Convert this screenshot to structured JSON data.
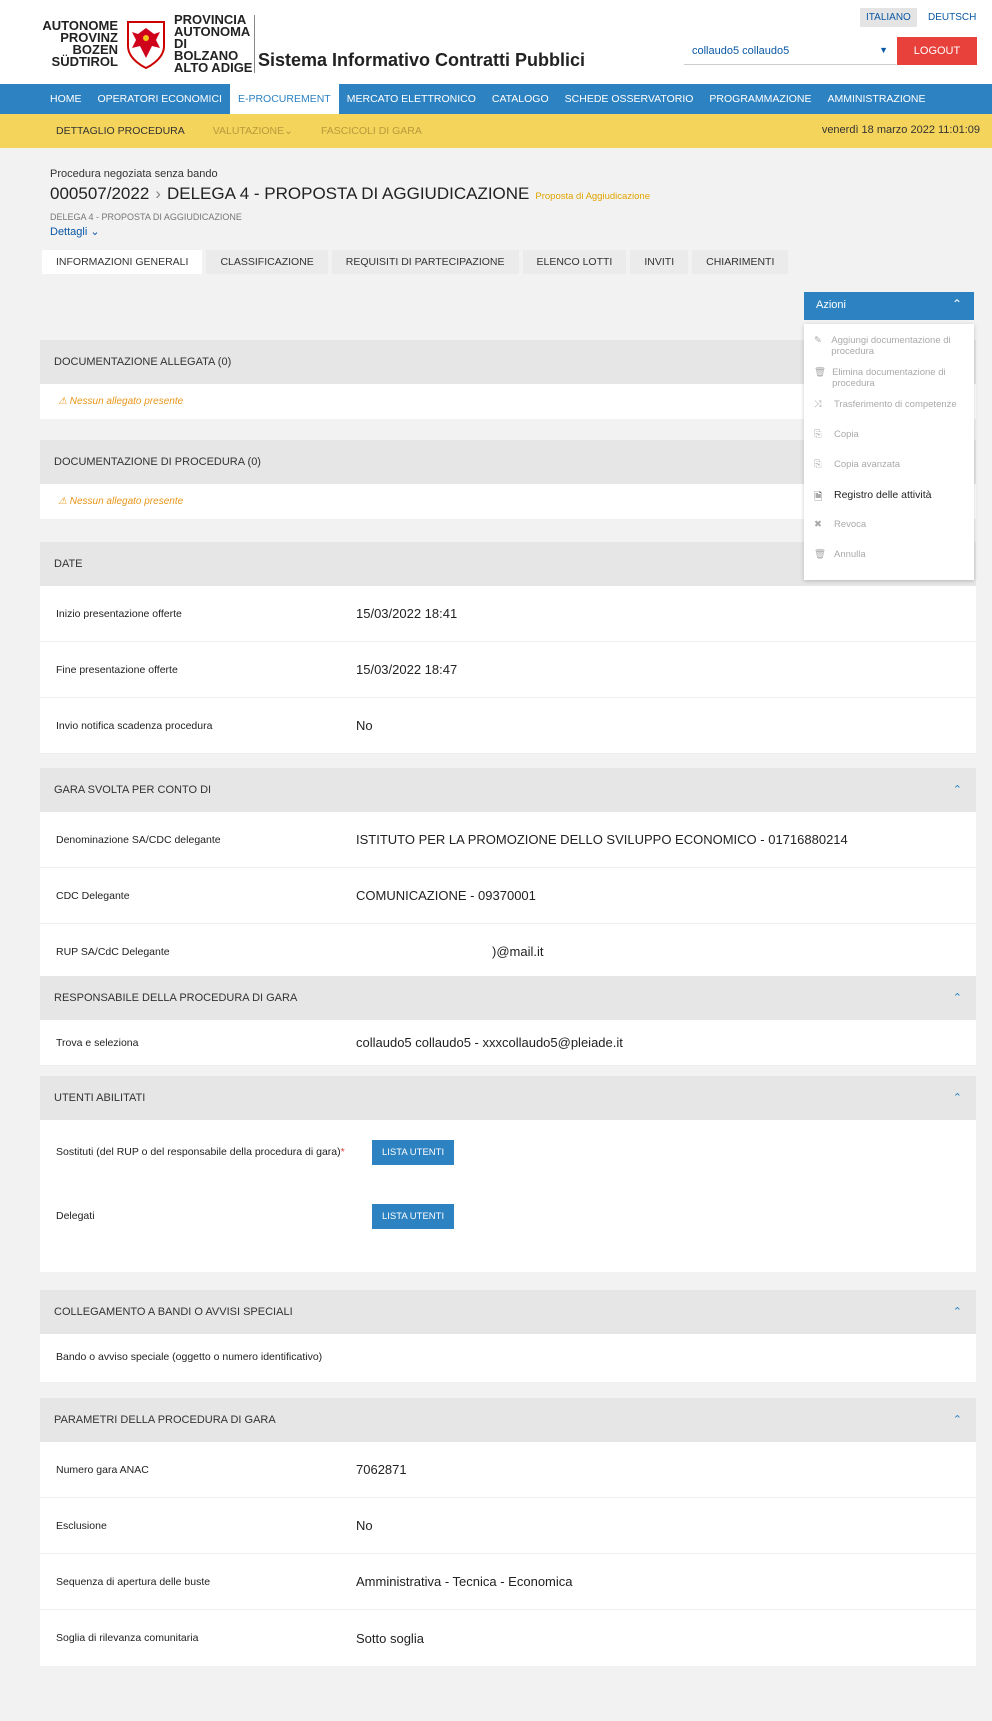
{
  "header": {
    "logo_left_lines": [
      "AUTONOME",
      "PROVINZ",
      "BOZEN",
      "SÜDTIROL"
    ],
    "logo_right_lines": [
      "PROVINCIA",
      "AUTONOMA",
      "DI BOLZANO",
      "ALTO ADIGE"
    ],
    "app_title": "Sistema Informativo Contratti Pubblici",
    "lang_it": "ITALIANO",
    "lang_de": "DEUTSCH",
    "user": "collaudo5 collaudo5",
    "logout": "LOGOUT"
  },
  "nav": {
    "items": [
      "HOME",
      "OPERATORI ECONOMICI",
      "E-PROCUREMENT",
      "MERCATO ELETTRONICO",
      "CATALOGO",
      "SCHEDE OSSERVATORIO",
      "PROGRAMMAZIONE",
      "AMMINISTRAZIONE"
    ],
    "active_index": 2
  },
  "subnav": {
    "items": [
      "DETTAGLIO PROCEDURA",
      "VALUTAZIONE",
      "FASCICOLI DI GARA"
    ],
    "datetime": "venerdì 18 marzo 2022 11:01:09"
  },
  "procedure": {
    "type": "Procedura negoziata senza bando",
    "code": "000507/2022",
    "name": "DELEGA 4 - PROPOSTA DI AGGIUDICAZIONE",
    "status": "Proposta di Aggiudicazione",
    "subtitle": "DELEGA 4 - PROPOSTA DI AGGIUDICAZIONE",
    "details": "Dettagli"
  },
  "tabs": [
    "INFORMAZIONI GENERALI",
    "CLASSIFICAZIONE",
    "REQUISITI DI PARTECIPAZIONE",
    "ELENCO LOTTI",
    "INVITI",
    "CHIARIMENTI"
  ],
  "actions": {
    "button": "Azioni",
    "items": [
      {
        "label": "Aggiungi documentazione di procedura",
        "icon": "edit-icon",
        "glyph": "✎",
        "enabled": false
      },
      {
        "label": "Elimina documentazione di procedura",
        "icon": "trash-icon",
        "glyph": "🗑",
        "enabled": false
      },
      {
        "label": "Trasferimento di competenze",
        "icon": "shuffle-icon",
        "glyph": "⤨",
        "enabled": false
      },
      {
        "label": "Copia",
        "icon": "copy-icon",
        "glyph": "⎘",
        "enabled": false
      },
      {
        "label": "Copia avanzata",
        "icon": "copy-advanced-icon",
        "glyph": "⎘",
        "enabled": false
      },
      {
        "label": "Registro delle attività",
        "icon": "document-icon",
        "glyph": "🗎",
        "enabled": true
      },
      {
        "label": "Revoca",
        "icon": "revoke-icon",
        "glyph": "✖",
        "enabled": false
      },
      {
        "label": "Annulla",
        "icon": "cancel-icon",
        "glyph": "🗑",
        "enabled": false
      }
    ]
  },
  "sections": {
    "doc_allegata": {
      "title": "DOCUMENTAZIONE ALLEGATA (0)",
      "warn": "Nessun allegato presente"
    },
    "doc_procedura": {
      "title": "DOCUMENTAZIONE DI PROCEDURA (0)",
      "warn": "Nessun allegato presente"
    },
    "date": {
      "title": "DATE",
      "rows": [
        {
          "label": "Inizio presentazione offerte",
          "value": "15/03/2022 18:41"
        },
        {
          "label": "Fine presentazione offerte",
          "value": "15/03/2022 18:47"
        },
        {
          "label": "Invio notifica scadenza procedura",
          "value": "No"
        }
      ]
    },
    "conto_di": {
      "title": "GARA SVOLTA PER CONTO DI",
      "rows": [
        {
          "label": "Denominazione SA/CDC delegante",
          "value": "ISTITUTO PER LA PROMOZIONE DELLO SVILUPPO ECONOMICO - 01716880214"
        },
        {
          "label": "CDC Delegante",
          "value": "COMUNICAZIONE - 09370001"
        },
        {
          "label": "RUP SA/CdC Delegante",
          "value": ")@mail.it"
        }
      ]
    },
    "responsabile": {
      "title": "RESPONSABILE DELLA PROCEDURA DI GARA",
      "rows": [
        {
          "label": "Trova e seleziona",
          "value": "collaudo5 collaudo5 - xxxcollaudo5@pleiade.it"
        }
      ]
    },
    "utenti": {
      "title": "UTENTI ABILITATI",
      "sostituti_label": "Sostituti (del RUP o del responsabile della procedura di gara)",
      "required_mark": "*",
      "delegati_label": "Delegati",
      "button": "LISTA UTENTI"
    },
    "collegamento": {
      "title": "COLLEGAMENTO A BANDI O AVVISI SPECIALI",
      "rows": [
        {
          "label": "Bando o avviso speciale (oggetto o numero identificativo)",
          "value": ""
        }
      ]
    },
    "parametri": {
      "title": "PARAMETRI DELLA PROCEDURA DI GARA",
      "rows": [
        {
          "label": "Numero gara ANAC",
          "value": "7062871"
        },
        {
          "label": "Esclusione",
          "value": "No"
        },
        {
          "label": "Sequenza di apertura delle buste",
          "value": "Amministrativa - Tecnica - Economica"
        },
        {
          "label": "Soglia di rilevanza comunitaria",
          "value": "Sotto soglia"
        }
      ]
    }
  }
}
